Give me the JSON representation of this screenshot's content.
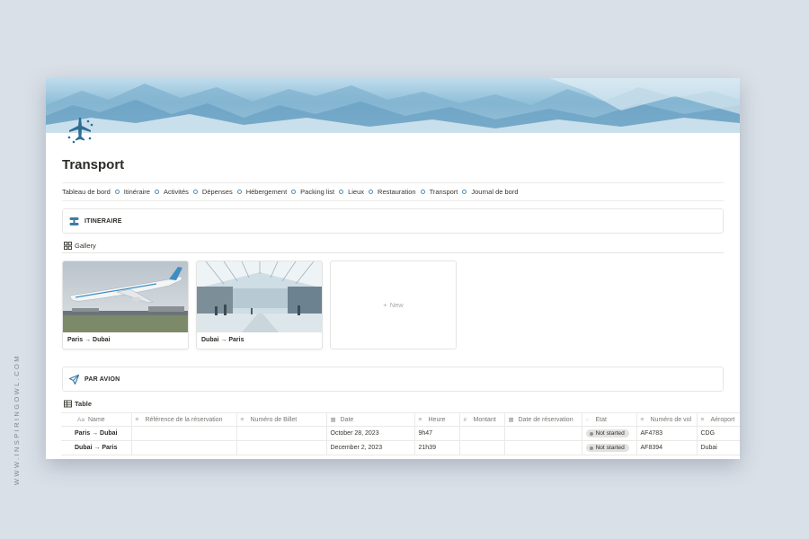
{
  "watermark": "WWW.INSPIRINGOWL.COM",
  "page": {
    "title": "Transport",
    "icon": "airplane-icon"
  },
  "nav": {
    "items": [
      "Tableau de bord",
      "Itinéraire",
      "Activités",
      "Dépenses",
      "Hébergement",
      "Packing list",
      "Lieux",
      "Restauration",
      "Transport",
      "Journal de bord"
    ]
  },
  "itineraire": {
    "heading": "ITINERAIRE",
    "icon": "route-icon",
    "view_label": "Gallery",
    "cards": [
      {
        "caption": "Paris → Dubai",
        "image": "airplane-takeoff-photo"
      },
      {
        "caption": "Dubai → Paris",
        "image": "airport-terminal-photo"
      }
    ],
    "new_label": "New"
  },
  "avion": {
    "heading": "PAR AVION",
    "icon": "paper-plane-icon",
    "view_label": "Table",
    "columns": [
      {
        "label": "Name",
        "icon": "Aa"
      },
      {
        "label": "Référence de la réservation",
        "icon": "text-icon"
      },
      {
        "label": "Numéro de Billet",
        "icon": "text-icon"
      },
      {
        "label": "Date",
        "icon": "calendar-icon"
      },
      {
        "label": "Heure",
        "icon": "text-icon"
      },
      {
        "label": "Montant",
        "icon": "#"
      },
      {
        "label": "Date de réservation",
        "icon": "calendar-icon"
      },
      {
        "label": "Etat",
        "icon": "status-icon"
      },
      {
        "label": "Numéro de vol",
        "icon": "text-icon"
      },
      {
        "label": "Aéroport",
        "icon": "text-icon"
      }
    ],
    "rows": [
      {
        "name": "Paris → Dubai",
        "reference": "",
        "billet": "",
        "date": "October 28, 2023",
        "heure": "9h47",
        "montant": "",
        "date_reservation": "",
        "etat": "Not started",
        "vol": "AF4783",
        "aeroport": "CDG"
      },
      {
        "name": "Dubai → Paris",
        "reference": "",
        "billet": "",
        "date": "December 2, 2023",
        "heure": "21h39",
        "montant": "",
        "date_reservation": "",
        "etat": "Not started",
        "vol": "AF8394",
        "aeroport": "Dubai"
      }
    ]
  },
  "colors": {
    "accent": "#4a8fb7",
    "badge_bg": "#e3e2e0",
    "background": "#d9e0e8"
  }
}
